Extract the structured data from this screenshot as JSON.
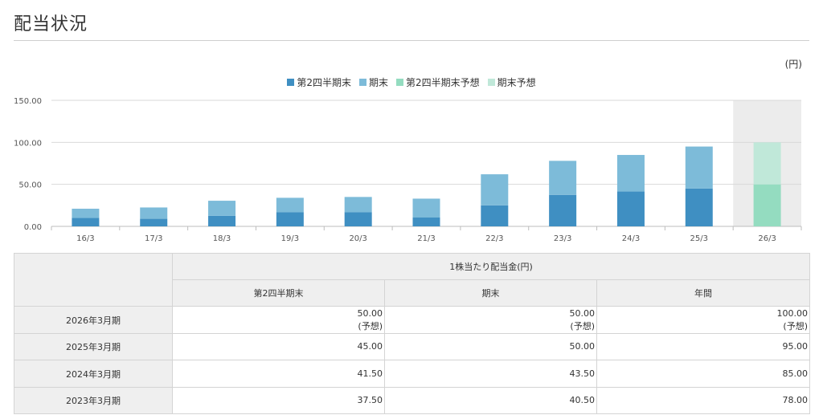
{
  "page": {
    "title": "配当状況",
    "unit": "(円)"
  },
  "legend": [
    {
      "label": "第2四半期末",
      "color": "#3f8fc2"
    },
    {
      "label": "期末",
      "color": "#7dbbd9"
    },
    {
      "label": "第2四半期末予想",
      "color": "#94dcc0"
    },
    {
      "label": "期末予想",
      "color": "#c0e8d9"
    }
  ],
  "chart_data": {
    "type": "bar",
    "stacked": true,
    "categories": [
      "16/3",
      "17/3",
      "18/3",
      "19/3",
      "20/3",
      "21/3",
      "22/3",
      "23/3",
      "24/3",
      "25/3",
      "26/3"
    ],
    "series": [
      {
        "name": "第2四半期末",
        "values": [
          10,
          9,
          12.5,
          17,
          17,
          10.5,
          25,
          37.5,
          41.5,
          45,
          null
        ],
        "color": "#3f8fc2"
      },
      {
        "name": "期末",
        "values": [
          11,
          13.5,
          18,
          17,
          18,
          22.5,
          37,
          40.5,
          43.5,
          50,
          null
        ],
        "color": "#7dbbd9"
      },
      {
        "name": "第2四半期末予想",
        "values": [
          null,
          null,
          null,
          null,
          null,
          null,
          null,
          null,
          null,
          null,
          50
        ],
        "color": "#94dcc0"
      },
      {
        "name": "期末予想",
        "values": [
          null,
          null,
          null,
          null,
          null,
          null,
          null,
          null,
          null,
          null,
          50
        ],
        "color": "#c0e8d9"
      }
    ],
    "yticks": [
      "0.00",
      "50.00",
      "100.00",
      "150.00"
    ],
    "ylim": [
      0,
      150
    ],
    "highlight_category": "26/3",
    "highlight_color": "#ececec",
    "grid": true
  },
  "table": {
    "group_header": "1株当たり配当金(円)",
    "columns": [
      "第2四半期末",
      "期末",
      "年間"
    ],
    "rows": [
      {
        "period": "2026年3月期",
        "values": [
          "50.00",
          "50.00",
          "100.00"
        ],
        "notes": [
          "(予想)",
          "(予想)",
          "(予想)"
        ]
      },
      {
        "period": "2025年3月期",
        "values": [
          "45.00",
          "50.00",
          "95.00"
        ]
      },
      {
        "period": "2024年3月期",
        "values": [
          "41.50",
          "43.50",
          "85.00"
        ]
      },
      {
        "period": "2023年3月期",
        "values": [
          "37.50",
          "40.50",
          "78.00"
        ]
      }
    ]
  }
}
